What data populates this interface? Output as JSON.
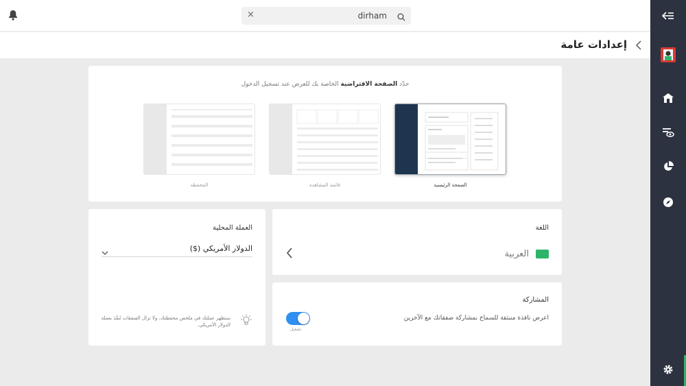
{
  "search": {
    "value": "dirham",
    "clear_icon": "close-icon",
    "icon": "search-icon"
  },
  "header": {
    "title": "إعدادات عامة"
  },
  "default_page": {
    "hint_prefix": "حدّد",
    "hint_bold": "الصفحة الافتراضية",
    "hint_suffix": "الخاصة بك للعرض عند تسجيل الدخول",
    "options": [
      {
        "label": "الصفحة الرئيسية",
        "selected": true
      },
      {
        "label": "قائمة المشاهدة",
        "selected": false
      },
      {
        "label": "المحفظة",
        "selected": false
      }
    ]
  },
  "language": {
    "title": "اللغة",
    "value": "العربية"
  },
  "sharing": {
    "title": "المشاركة",
    "description": "اعرض نافذة منبثقة للسماح بمشاركة صفقاتك مع الآخرين",
    "toggle_label": "تشغيل",
    "toggle_on": true
  },
  "currency": {
    "title": "العملة المحلية",
    "selected": "الدولار الأمريكي ($)",
    "note": "ستظهر عملتك في ملخص محفظتك، ولا تزال الصفقات تُنفّذ بعملة الدولار الأمريكي."
  },
  "colors": {
    "rail": "#2c3240",
    "accent": "#2db46a",
    "toggle": "#2f8ff2",
    "thumb_dark": "#1e3550"
  },
  "rail_icons": [
    "collapse-arrow-icon",
    "avatar",
    "home-icon",
    "watchlist-icon",
    "portfolio-pie-icon",
    "discover-icon",
    "settings-gear-icon"
  ]
}
